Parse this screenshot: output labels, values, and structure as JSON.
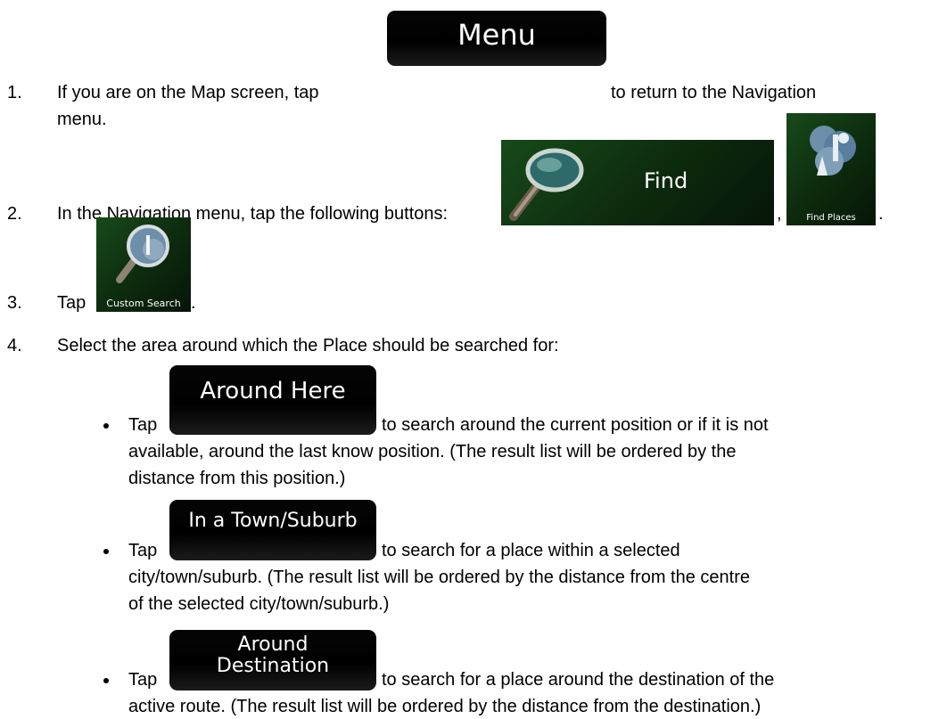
{
  "steps": [
    {
      "num": "1.",
      "before": "If you are on the Map screen, tap",
      "after": "to return to the Navigation",
      "cont": "menu."
    },
    {
      "num": "2.",
      "before": "In the Navigation menu, tap the following buttons:",
      "sep": ",",
      "end": "."
    },
    {
      "num": "3.",
      "before": "Tap",
      "end": "."
    },
    {
      "num": "4.",
      "before": "Select the area around which the Place should be searched for:"
    }
  ],
  "buttons": {
    "menu": "Menu",
    "find": "Find",
    "find_places": "Find Places",
    "custom_search": "Custom Search",
    "around_here": "Around Here",
    "in_a_town": "In a Town/Suburb",
    "around_dest_line1": "Around",
    "around_dest_line2": "Destination"
  },
  "bullets": [
    {
      "tap": "Tap",
      "lines": [
        "to search around the current position or if it is not",
        "available, around the last know position. (The result list will be ordered by the",
        "distance from this position.)"
      ]
    },
    {
      "tap": "Tap",
      "lines": [
        "to search for a place within a selected",
        "city/town/suburb. (The result list will be ordered by the distance from the centre",
        "of the selected city/town/suburb.)"
      ]
    },
    {
      "tap": "Tap",
      "lines": [
        "to search for a place around the destination of the",
        "active route. (The result list will be ordered by the distance from the destination.)"
      ]
    }
  ]
}
